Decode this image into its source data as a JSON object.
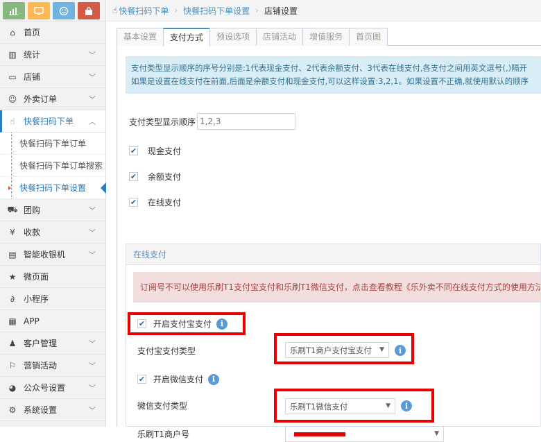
{
  "toolbar": {
    "icons": [
      {
        "name": "chart-icon",
        "color": "#87b87f"
      },
      {
        "name": "monitor-icon",
        "color": "#ffb752"
      },
      {
        "name": "smile-icon",
        "color": "#6fb3e0"
      },
      {
        "name": "bag-icon",
        "color": "#d15b47"
      }
    ]
  },
  "sidebar": {
    "items": [
      {
        "label": "首页",
        "icon": "home-icon"
      },
      {
        "label": "统计",
        "icon": "bar-chart-icon"
      },
      {
        "label": "店铺",
        "icon": "desktop-icon"
      },
      {
        "label": "外卖订单",
        "icon": "smile-icon"
      },
      {
        "label": "快餐扫码下单",
        "icon": "hand-pointer-icon"
      },
      {
        "label": "团购",
        "icon": "cart-icon"
      },
      {
        "label": "收款",
        "icon": "yen-icon"
      },
      {
        "label": "智能收银机",
        "icon": "register-icon"
      },
      {
        "label": "微页面",
        "icon": "star-icon"
      },
      {
        "label": "小程序",
        "icon": "link-icon"
      },
      {
        "label": "APP",
        "icon": "grid-icon"
      },
      {
        "label": "客户管理",
        "icon": "users-icon"
      },
      {
        "label": "营销活动",
        "icon": "flag-icon"
      },
      {
        "label": "公众号设置",
        "icon": "wechat-icon"
      },
      {
        "label": "系统设置",
        "icon": "gear-icon"
      }
    ],
    "subitems": [
      "快餐扫码下单订单",
      "快餐扫码下单订单搜索",
      "快餐扫码下单设置"
    ]
  },
  "breadcrumb": {
    "b1": "快餐扫码下单",
    "b2": "快餐扫码下单设置",
    "b3": "店铺设置"
  },
  "tabs": [
    "基本设置",
    "支付方式",
    "预设选项",
    "店铺活动",
    "增值服务",
    "首页图"
  ],
  "info": {
    "line1": "支付类型显示顺序的序号分别是:1代表现金支付、2代表余额支付、3代表在线支付,各支付之间用英文逗号(,)隔开",
    "line2": "如果是设置在线支付在前面,后面是余额支付和现金支付,可以这样设置:3,2,1。如果设置不正确,就使用默认的顺序"
  },
  "form": {
    "order_label": "支付类型显示顺序",
    "order_placeholder": "1,2,3",
    "cash": "现金支付",
    "balance": "余额支付",
    "online": "在线支付"
  },
  "online": {
    "header": "在线支付",
    "warning": "订阅号不可以使用乐刷T1支付宝支付和乐刷T1微信支付，点击查看教程《乐外卖不同在线支付方式的使用方法",
    "alipay_enable": "开启支付宝支付",
    "alipay_type_label": "支付宝支付类型",
    "alipay_type_value": "乐刷T1商户支付宝支付",
    "wechat_enable": "开启微信支付",
    "wechat_type_label": "微信支付类型",
    "wechat_type_value": "乐刷T1微信支付",
    "merchant_label": "乐刷T1商户号"
  }
}
